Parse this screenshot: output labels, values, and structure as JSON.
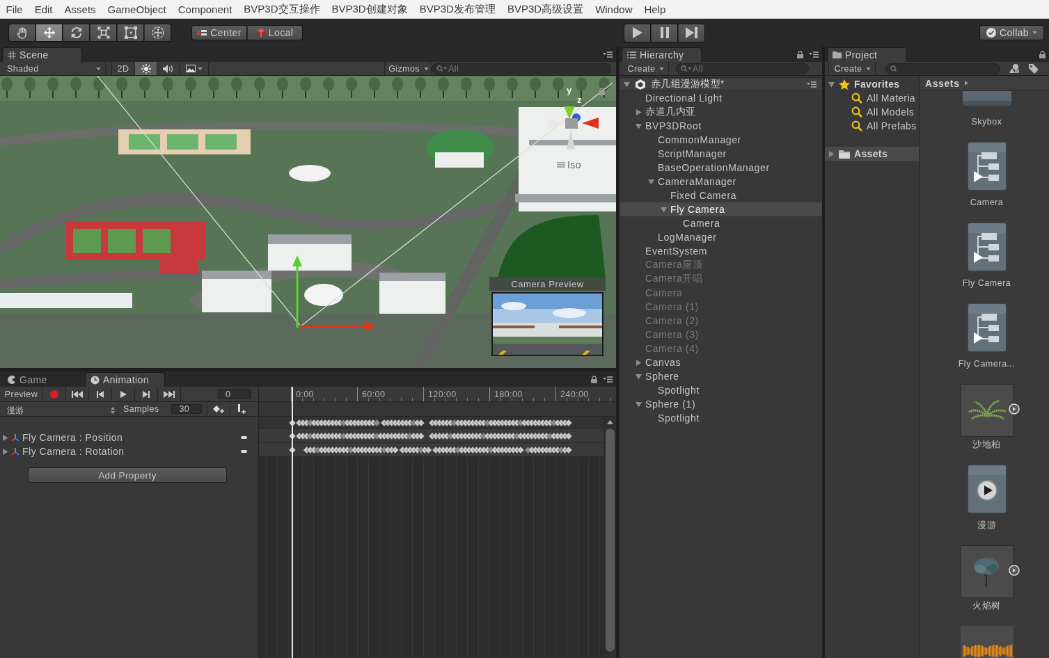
{
  "menu_bar": [
    "File",
    "Edit",
    "Assets",
    "GameObject",
    "Component",
    "BVP3D交互操作",
    "BVP3D创建对象",
    "BVP3D发布管理",
    "BVP3D高级设置",
    "Window",
    "Help"
  ],
  "toolbar": {
    "tools": [
      {
        "kind": "hand",
        "selected": false
      },
      {
        "kind": "move",
        "selected": true
      },
      {
        "kind": "rotate",
        "selected": false
      },
      {
        "kind": "scale",
        "selected": false
      },
      {
        "kind": "rect",
        "selected": false
      },
      {
        "kind": "transform",
        "selected": false
      }
    ],
    "pivot": [
      {
        "kind": "center",
        "label": "Center"
      },
      {
        "kind": "local",
        "label": "Local"
      }
    ],
    "playback": [
      {
        "kind": "play"
      },
      {
        "kind": "pause"
      },
      {
        "kind": "step"
      }
    ],
    "collab": "Collab"
  },
  "scene": {
    "tab": "Scene",
    "shading": "Shaded",
    "toggles": [
      {
        "kind": "dimension",
        "label": "2D",
        "on": false
      },
      {
        "kind": "lighting",
        "on": true
      },
      {
        "kind": "audio",
        "on": false
      },
      {
        "kind": "effects",
        "on": false
      }
    ],
    "gizmos": "Gizmos",
    "search": {
      "placeholder": "All"
    },
    "gizmo": {
      "y_label": "y",
      "z_label": "z",
      "projection": "Iso"
    },
    "camera_preview": {
      "title": "Camera Preview"
    }
  },
  "bottom_panel": {
    "tabs": [
      {
        "kind": "game",
        "label": "Game",
        "selected": false
      },
      {
        "kind": "animation",
        "label": "Animation",
        "selected": true
      }
    ],
    "animation": {
      "preview": "Preview",
      "controls": [
        {
          "kind": "record"
        },
        {
          "kind": "first_key"
        },
        {
          "kind": "prev_key"
        },
        {
          "kind": "play"
        },
        {
          "kind": "next_key"
        },
        {
          "kind": "last_key"
        }
      ],
      "frame": "0",
      "clip": "漫游",
      "samples_label": "Samples",
      "samples": "30",
      "ruler": [
        "0:00",
        "60:00",
        "120:00",
        "180:00",
        "240:00"
      ],
      "properties": [
        {
          "label": "Fly Camera : Position",
          "expanded": false
        },
        {
          "label": "Fly Camera : Rotation",
          "expanded": false
        }
      ],
      "add_property": "Add Property"
    }
  },
  "hierarchy": {
    "tab": "Hierarchy",
    "create": "Create",
    "search": {
      "placeholder": "All"
    },
    "scene": {
      "name": "赤几组漫游模型*",
      "expanded": true
    },
    "items": [
      {
        "label": "Directional Light",
        "expandable": false,
        "expanded": false,
        "disabled": false,
        "selected": false
      },
      {
        "label": "赤道几内亚",
        "expandable": true,
        "expanded": false,
        "disabled": false,
        "selected": false
      },
      {
        "label": "BVP3DRoot",
        "expandable": true,
        "expanded": true,
        "disabled": false,
        "selected": false,
        "children": [
          {
            "label": "CommonManager",
            "expandable": false,
            "expanded": false,
            "disabled": false,
            "selected": false
          },
          {
            "label": "ScriptManager",
            "expandable": false,
            "expanded": false,
            "disabled": false,
            "selected": false
          },
          {
            "label": "BaseOperationManager",
            "expandable": false,
            "expanded": false,
            "disabled": false,
            "selected": false
          },
          {
            "label": "CameraManager",
            "expandable": true,
            "expanded": true,
            "disabled": false,
            "selected": false,
            "children": [
              {
                "label": "Fixed Camera",
                "expandable": false,
                "expanded": false,
                "disabled": false,
                "selected": false
              },
              {
                "label": "Fly Camera",
                "expandable": true,
                "expanded": true,
                "disabled": false,
                "selected": true,
                "children": [
                  {
                    "label": "Camera",
                    "expandable": false,
                    "expanded": false,
                    "disabled": false,
                    "selected": false
                  }
                ]
              }
            ]
          },
          {
            "label": "LogManager",
            "expandable": false,
            "expanded": false,
            "disabled": false,
            "selected": false
          }
        ]
      },
      {
        "label": "EventSystem",
        "expandable": false,
        "expanded": false,
        "disabled": false,
        "selected": false
      },
      {
        "label": "Camera屋顶",
        "expandable": false,
        "expanded": false,
        "disabled": true,
        "selected": false
      },
      {
        "label": "Camera开唱",
        "expandable": false,
        "expanded": false,
        "disabled": true,
        "selected": false
      },
      {
        "label": "Camera",
        "expandable": false,
        "expanded": false,
        "disabled": true,
        "selected": false
      },
      {
        "label": "Camera (1)",
        "expandable": false,
        "expanded": false,
        "disabled": true,
        "selected": false
      },
      {
        "label": "Camera (2)",
        "expandable": false,
        "expanded": false,
        "disabled": true,
        "selected": false
      },
      {
        "label": "Camera (3)",
        "expandable": false,
        "expanded": false,
        "disabled": true,
        "selected": false
      },
      {
        "label": "Camera (4)",
        "expandable": false,
        "expanded": false,
        "disabled": true,
        "selected": false
      },
      {
        "label": "Canvas",
        "expandable": true,
        "expanded": false,
        "disabled": false,
        "selected": false
      },
      {
        "label": "Sphere",
        "expandable": true,
        "expanded": true,
        "disabled": false,
        "selected": false,
        "children": [
          {
            "label": "Spotlight",
            "expandable": false,
            "expanded": false,
            "disabled": false,
            "selected": false
          }
        ]
      },
      {
        "label": "Sphere (1)",
        "expandable": true,
        "expanded": true,
        "disabled": false,
        "selected": false,
        "children": [
          {
            "label": "Spotlight",
            "expandable": false,
            "expanded": false,
            "disabled": false,
            "selected": false
          }
        ]
      }
    ]
  },
  "project": {
    "tab": "Project",
    "create": "Create",
    "tree": [
      {
        "kind": "favorites",
        "label": "Favorites",
        "expandable": true,
        "expanded": true,
        "selected": false,
        "children": [
          {
            "kind": "search",
            "label": "All Materia",
            "expandable": false,
            "expanded": false,
            "selected": false
          },
          {
            "kind": "search",
            "label": "All Models",
            "expandable": false,
            "expanded": false,
            "selected": false
          },
          {
            "kind": "search",
            "label": "All Prefabs",
            "expandable": false,
            "expanded": false,
            "selected": false
          }
        ]
      },
      {
        "kind": "folder",
        "label": "Assets",
        "expandable": true,
        "expanded": false,
        "selected": true
      }
    ],
    "breadcrumb": "Assets",
    "assets": [
      {
        "kind": "material",
        "name": "Skybox"
      },
      {
        "kind": "controller",
        "name": "Camera"
      },
      {
        "kind": "controller",
        "name": "Fly Camera"
      },
      {
        "kind": "controller",
        "name": "Fly Camera..."
      },
      {
        "kind": "fern",
        "name": "沙地柏"
      },
      {
        "kind": "clip",
        "name": "漫游"
      },
      {
        "kind": "tree",
        "name": "火焰树"
      },
      {
        "kind": "audio"
      }
    ]
  }
}
